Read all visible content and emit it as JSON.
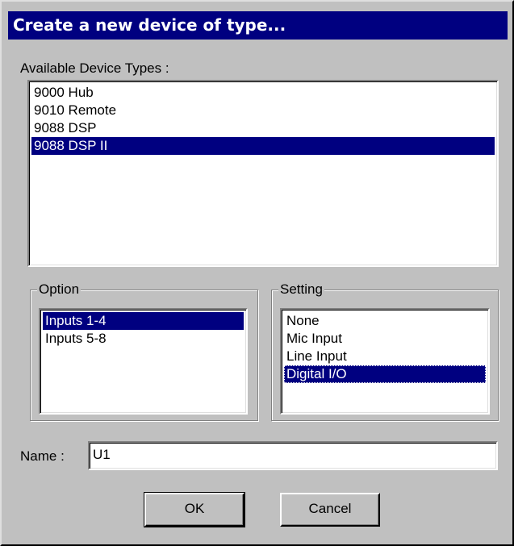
{
  "title": "Create a new device of type...",
  "available": {
    "label": "Available Device Types :",
    "items": [
      "9000 Hub",
      "9010 Remote",
      "9088 DSP",
      "9088 DSP II"
    ],
    "selected": 3
  },
  "option": {
    "legend": "Option",
    "items": [
      "Inputs 1-4",
      "Inputs 5-8"
    ],
    "selected": 0
  },
  "setting": {
    "legend": "Setting",
    "items": [
      "None",
      "Mic Input",
      "Line Input",
      "Digital I/O"
    ],
    "selected": 3
  },
  "name": {
    "label": "Name :",
    "value": "U1"
  },
  "buttons": {
    "ok": "OK",
    "cancel": "Cancel"
  },
  "colors": {
    "face": "#c0c0c0",
    "selection": "#000080",
    "title_bg": "#000080"
  }
}
